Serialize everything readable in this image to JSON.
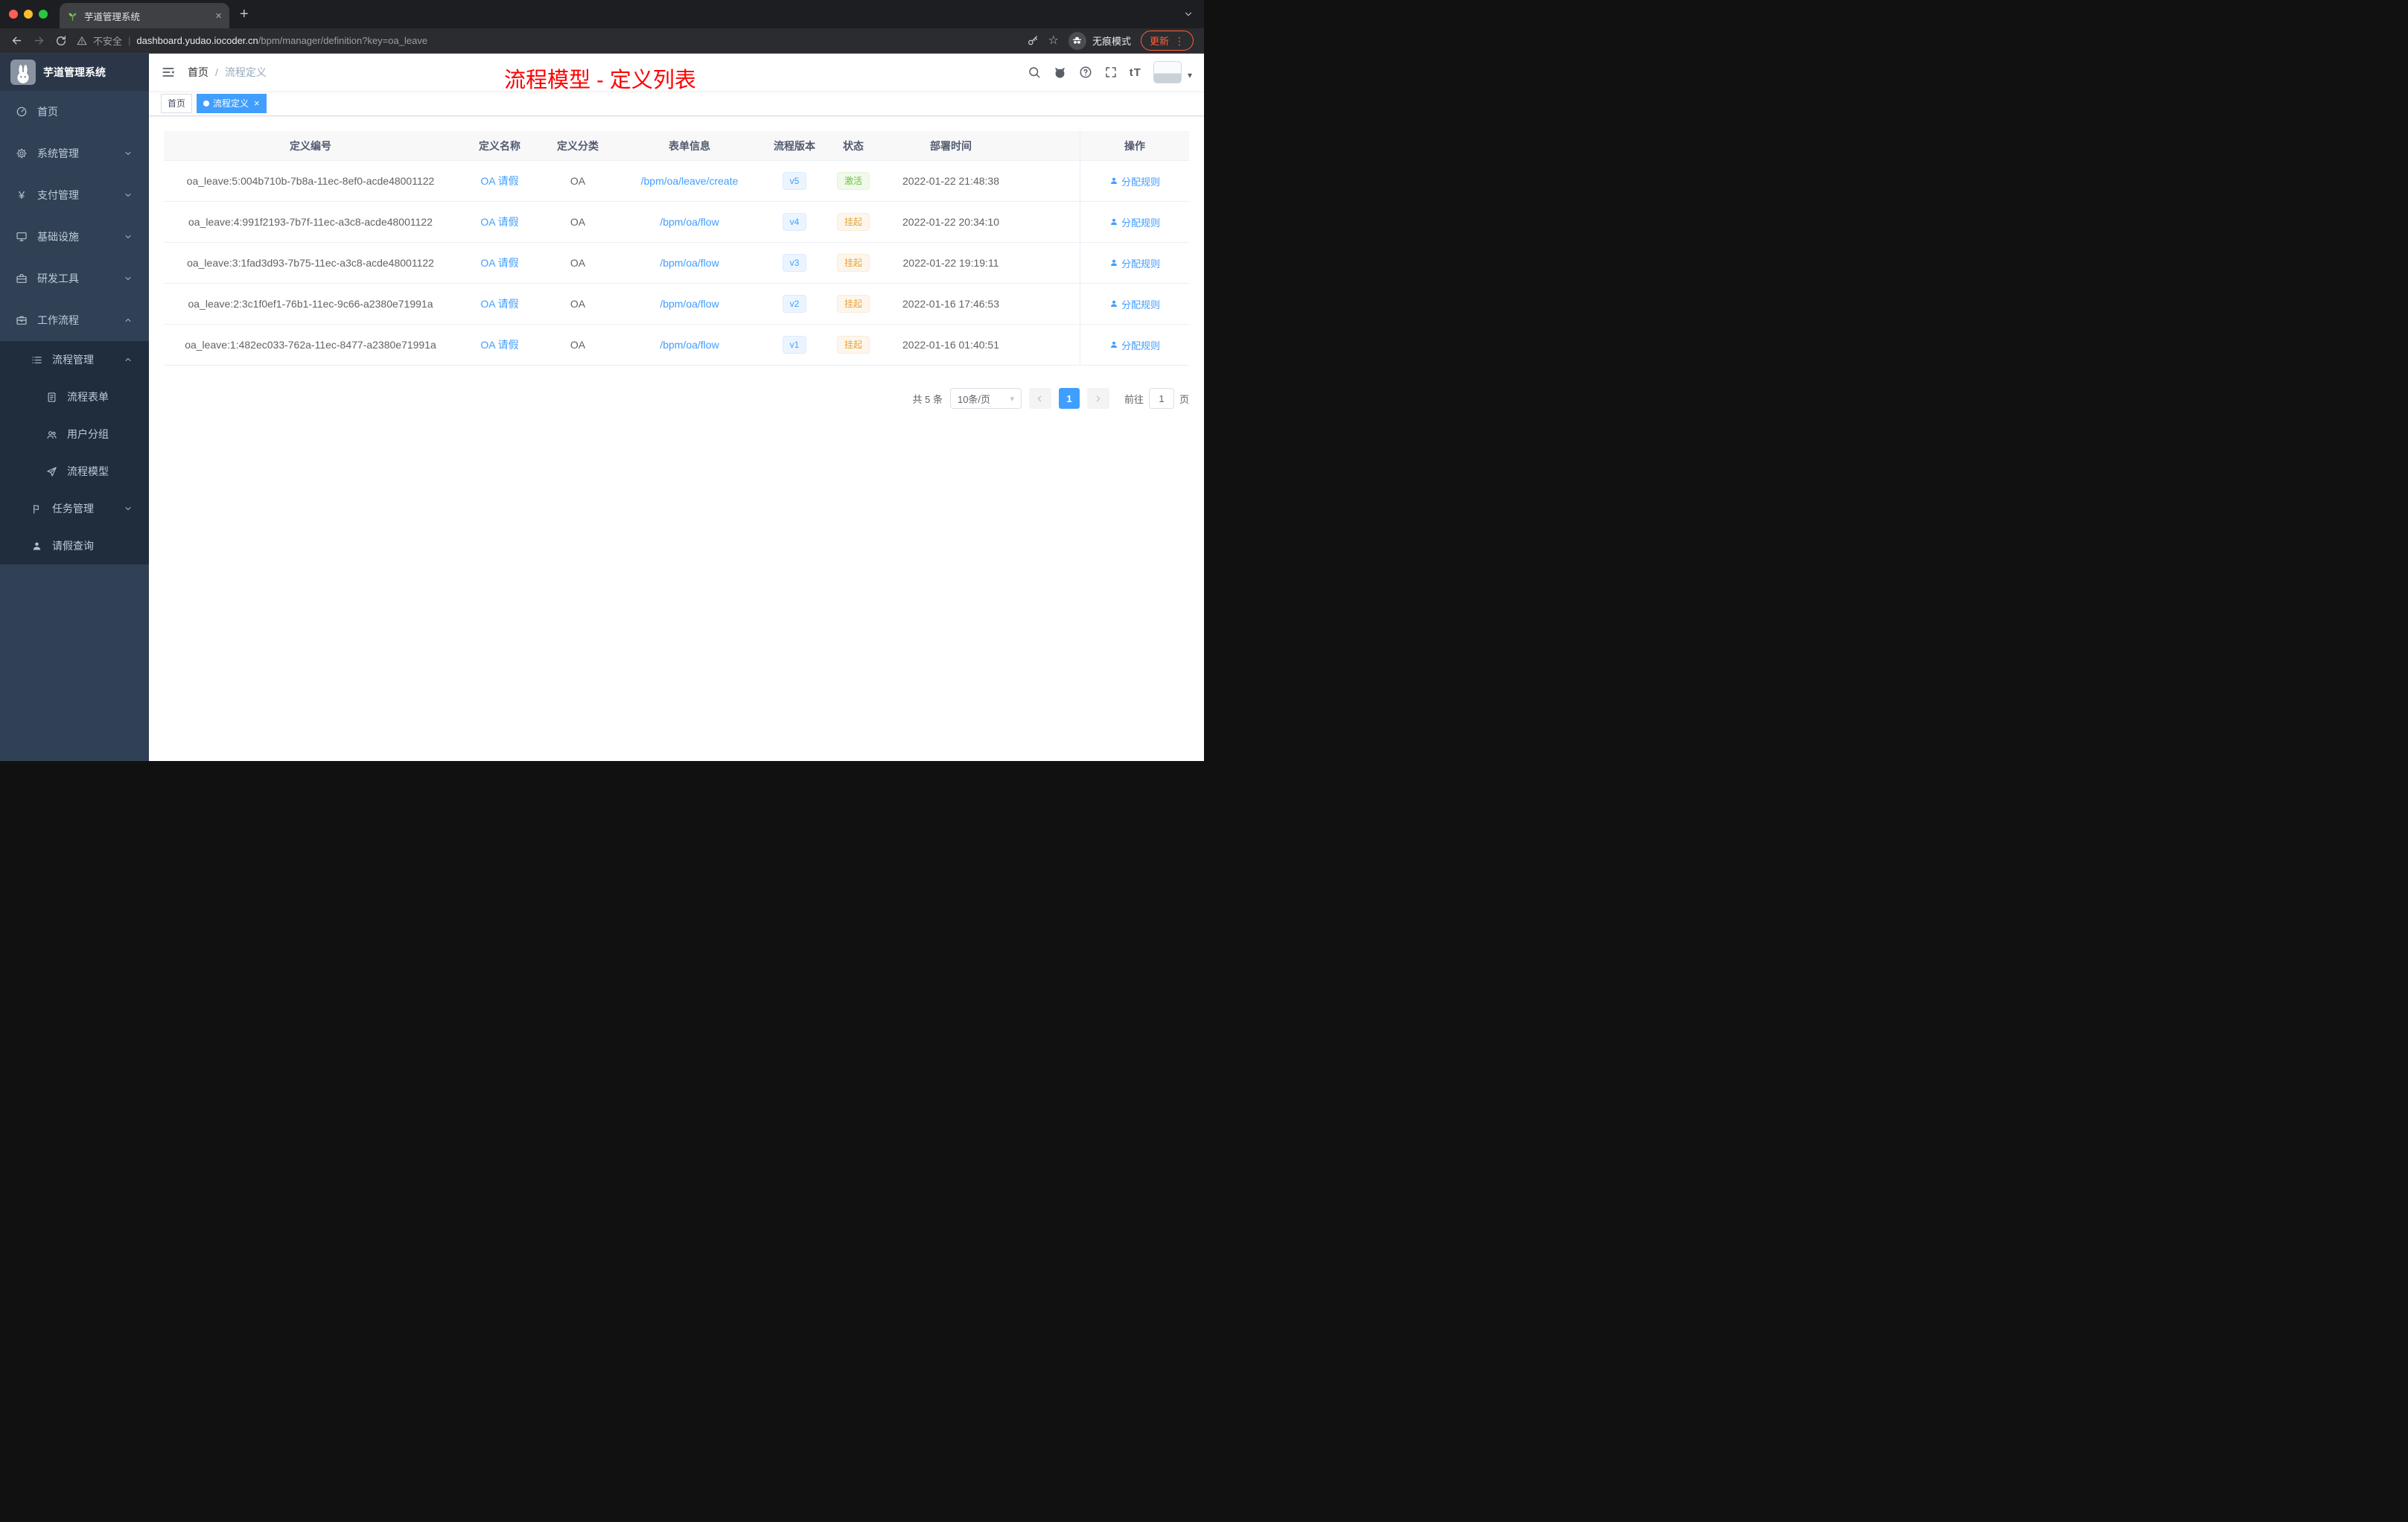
{
  "browser": {
    "tab_title": "芋道管理系统",
    "security_label": "不安全",
    "url_host": "dashboard.yudao.iocoder.cn",
    "url_path": "/bpm/manager/definition?key=oa_leave",
    "incognito_label": "无痕模式",
    "update_label": "更新"
  },
  "icons": {
    "close": "×",
    "plus": "+",
    "caret_down": "▾",
    "kebab": "⋮",
    "star": "☆",
    "yen": "¥",
    "font_size": "tT",
    "divider": "|",
    "slash": "/"
  },
  "sidebar": {
    "app_title": "芋道管理系统",
    "items": [
      {
        "label": "首页"
      },
      {
        "label": "系统管理"
      },
      {
        "label": "支付管理"
      },
      {
        "label": "基础设施"
      },
      {
        "label": "研发工具"
      },
      {
        "label": "工作流程"
      },
      {
        "label": "流程管理"
      },
      {
        "label": "流程表单"
      },
      {
        "label": "用户分组"
      },
      {
        "label": "流程模型"
      },
      {
        "label": "任务管理"
      },
      {
        "label": "请假查询"
      }
    ]
  },
  "header": {
    "breadcrumb_home": "首页",
    "breadcrumb_current": "流程定义",
    "annotation": "流程模型 - 定义列表",
    "annotation_color": "#fe0000"
  },
  "tags": {
    "home": "首页",
    "current": "流程定义"
  },
  "table": {
    "columns": [
      "定义编号",
      "定义名称",
      "定义分类",
      "表单信息",
      "流程版本",
      "状态",
      "部署时间",
      "操作"
    ],
    "rows": [
      {
        "id": "oa_leave:5:004b710b-7b8a-11ec-8ef0-acde48001122",
        "name": "OA 请假",
        "category": "OA",
        "form": "/bpm/oa/leave/create",
        "version": "v5",
        "status": "激活",
        "status_type": "success",
        "time": "2022-01-22 21:48:38",
        "action": "分配规则"
      },
      {
        "id": "oa_leave:4:991f2193-7b7f-11ec-a3c8-acde48001122",
        "name": "OA 请假",
        "category": "OA",
        "form": "/bpm/oa/flow",
        "version": "v4",
        "status": "挂起",
        "status_type": "warning",
        "time": "2022-01-22 20:34:10",
        "action": "分配规则"
      },
      {
        "id": "oa_leave:3:1fad3d93-7b75-11ec-a3c8-acde48001122",
        "name": "OA 请假",
        "category": "OA",
        "form": "/bpm/oa/flow",
        "version": "v3",
        "status": "挂起",
        "status_type": "warning",
        "time": "2022-01-22 19:19:11",
        "action": "分配规则"
      },
      {
        "id": "oa_leave:2:3c1f0ef1-76b1-11ec-9c66-a2380e71991a",
        "name": "OA 请假",
        "category": "OA",
        "form": "/bpm/oa/flow",
        "version": "v2",
        "status": "挂起",
        "status_type": "warning",
        "time": "2022-01-16 17:46:53",
        "action": "分配规则"
      },
      {
        "id": "oa_leave:1:482ec033-762a-11ec-8477-a2380e71991a",
        "name": "OA 请假",
        "category": "OA",
        "form": "/bpm/oa/flow",
        "version": "v1",
        "status": "挂起",
        "status_type": "warning",
        "time": "2022-01-16 01:40:51",
        "action": "分配规则"
      }
    ]
  },
  "pagination": {
    "total": "共 5 条",
    "size": "10条/页",
    "page": "1",
    "goto_label": "前往",
    "goto_value": "1",
    "unit": "页"
  }
}
